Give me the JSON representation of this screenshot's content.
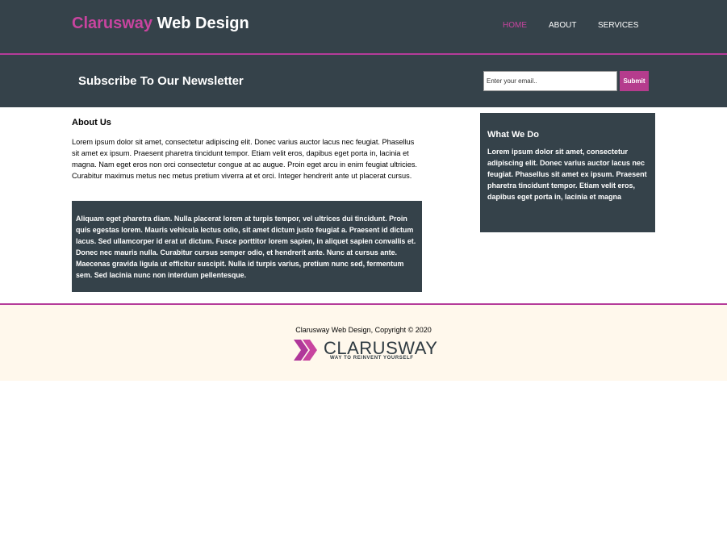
{
  "header": {
    "brand_accent": "Clarusway",
    "brand_rest": " Web Design",
    "nav": [
      {
        "label": "HOME",
        "active": true
      },
      {
        "label": "ABOUT",
        "active": false
      },
      {
        "label": "SERVICES",
        "active": false
      }
    ]
  },
  "newsletter": {
    "title": "Subscribe To Our Newsletter",
    "email_placeholder": "Enter your email..",
    "submit_label": "Submit"
  },
  "main": {
    "about_title": "About Us",
    "about_text": "Lorem ipsum dolor sit amet, consectetur adipiscing elit. Donec varius auctor lacus nec feugiat. Phasellus sit amet ex ipsum. Praesent pharetra tincidunt tempor. Etiam velit eros, dapibus eget porta in, lacinia et magna. Nam eget eros non orci consectetur congue at ac augue. Proin eget arcu in enim feugiat ultricies. Curabitur maximus metus nec metus pretium viverra at et orci. Integer hendrerit ante ut placerat cursus.",
    "dark_box_text": "Aliquam eget pharetra diam. Nulla placerat lorem at turpis tempor, vel ultrices dui tincidunt. Proin quis egestas lorem. Mauris vehicula lectus odio, sit amet dictum justo feugiat a. Praesent id dictum lacus. Sed ullamcorper id erat ut dictum. Fusce porttitor lorem sapien, in aliquet sapien convallis et. Donec nec mauris nulla. Curabitur cursus semper odio, et hendrerit ante. Nunc at cursus ante. Maecenas gravida ligula ut efficitur suscipit. Nulla id turpis varius, pretium nunc sed, fermentum sem. Sed lacinia nunc non interdum pellentesque."
  },
  "sidebar": {
    "title": "What We Do",
    "text": "Lorem ipsum dolor sit amet, consectetur adipiscing elit. Donec varius auctor lacus nec feugiat. Phasellus sit amet ex ipsum. Praesent pharetra tincidunt tempor. Etiam velit eros, dapibus eget porta in, lacinia et magna"
  },
  "footer": {
    "copyright": "Clarusway Web Design, Copyright © 2020",
    "logo_word": "CLARUSWAY",
    "logo_tagline": "WAY TO REINVENT YOURSELF"
  },
  "colors": {
    "dark_bg": "#35424a",
    "accent": "#c8449f",
    "footer_bg": "#fff8ec"
  },
  "icons": [
    "clarusway-chevron-logo-icon"
  ]
}
